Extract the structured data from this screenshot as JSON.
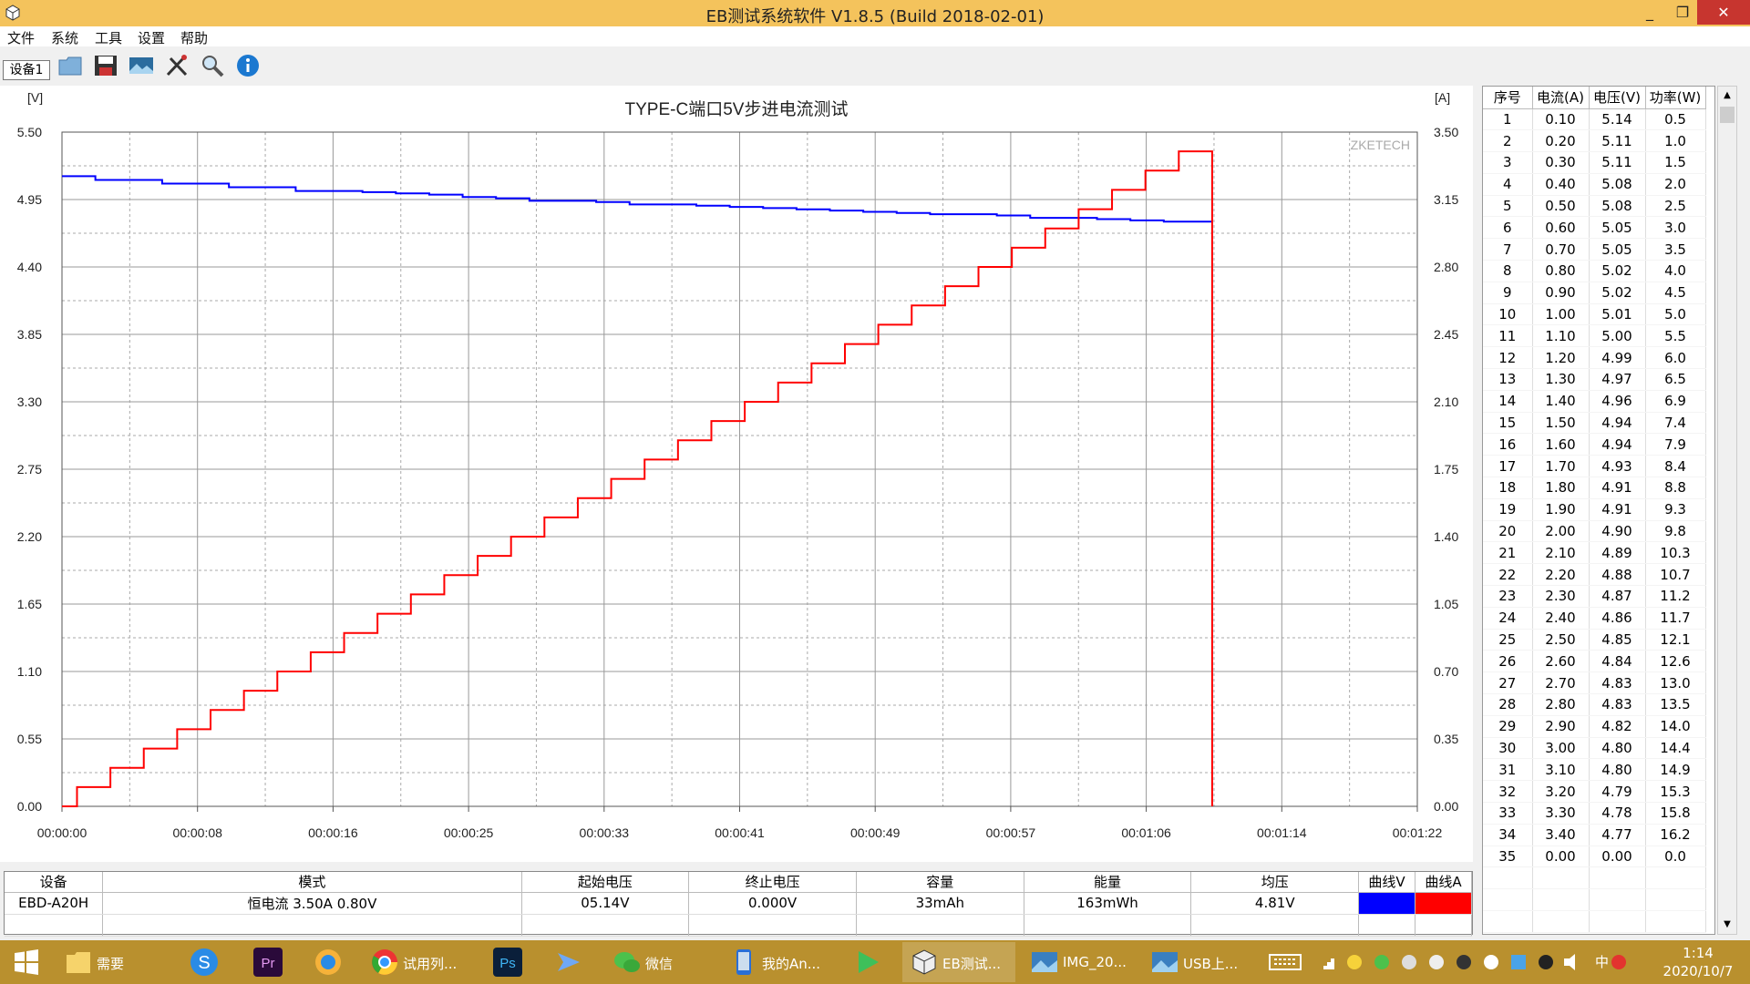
{
  "window": {
    "title": "EB测试系统软件 V1.8.5 (Build 2018-02-01)",
    "minimize": "_",
    "maximize": "❐",
    "close": "✕"
  },
  "menu": [
    "文件",
    "系统",
    "工具",
    "设置",
    "帮助"
  ],
  "toolbar": {
    "device_tab": "设备1",
    "icons": [
      "folder-icon",
      "save-icon",
      "picture-icon",
      "tools-icon",
      "search-icon",
      "info-icon"
    ]
  },
  "chart_labels": {
    "left_unit": "[V]",
    "right_unit": "[A]",
    "watermark": "ZKETECH"
  },
  "chart_data": {
    "type": "line",
    "title": "TYPE-C端口5V步进电流测试",
    "y_left": {
      "label": "[V]",
      "range": [
        0,
        5.5
      ],
      "ticks": [
        "0.00",
        "0.55",
        "1.10",
        "1.65",
        "2.20",
        "2.75",
        "3.30",
        "3.85",
        "4.40",
        "4.95",
        "5.50"
      ]
    },
    "y_right": {
      "label": "[A]",
      "range": [
        0,
        3.5
      ],
      "ticks": [
        "0.00",
        "0.35",
        "0.70",
        "1.05",
        "1.40",
        "1.75",
        "2.10",
        "2.45",
        "2.80",
        "3.15",
        "3.50"
      ]
    },
    "x": {
      "ticks": [
        "00:00:00",
        "00:00:08",
        "00:00:16",
        "00:00:25",
        "00:00:33",
        "00:00:41",
        "00:00:49",
        "00:00:57",
        "00:01:06",
        "00:01:14",
        "00:01:22"
      ]
    },
    "grid": true,
    "series": [
      {
        "name": "曲线V",
        "color": "#0000ff",
        "axis": "left",
        "values": [
          5.14,
          5.11,
          5.11,
          5.08,
          5.08,
          5.05,
          5.05,
          5.02,
          5.02,
          5.01,
          5.0,
          4.99,
          4.97,
          4.96,
          4.94,
          4.94,
          4.93,
          4.91,
          4.91,
          4.9,
          4.89,
          4.88,
          4.87,
          4.86,
          4.85,
          4.84,
          4.83,
          4.83,
          4.82,
          4.8,
          4.8,
          4.79,
          4.78,
          4.77
        ]
      },
      {
        "name": "曲线A",
        "color": "#ff0000",
        "axis": "right",
        "values": [
          0.1,
          0.2,
          0.3,
          0.4,
          0.5,
          0.6,
          0.7,
          0.8,
          0.9,
          1.0,
          1.1,
          1.2,
          1.3,
          1.4,
          1.5,
          1.6,
          1.7,
          1.8,
          1.9,
          2.0,
          2.1,
          2.2,
          2.3,
          2.4,
          2.5,
          2.6,
          2.7,
          2.8,
          2.9,
          3.0,
          3.1,
          3.2,
          3.3,
          3.4
        ]
      }
    ]
  },
  "data_table": {
    "headers": [
      "序号",
      "电流(A)",
      "电压(V)",
      "功率(W)"
    ],
    "rows": [
      [
        "1",
        "0.10",
        "5.14",
        "0.5"
      ],
      [
        "2",
        "0.20",
        "5.11",
        "1.0"
      ],
      [
        "3",
        "0.30",
        "5.11",
        "1.5"
      ],
      [
        "4",
        "0.40",
        "5.08",
        "2.0"
      ],
      [
        "5",
        "0.50",
        "5.08",
        "2.5"
      ],
      [
        "6",
        "0.60",
        "5.05",
        "3.0"
      ],
      [
        "7",
        "0.70",
        "5.05",
        "3.5"
      ],
      [
        "8",
        "0.80",
        "5.02",
        "4.0"
      ],
      [
        "9",
        "0.90",
        "5.02",
        "4.5"
      ],
      [
        "10",
        "1.00",
        "5.01",
        "5.0"
      ],
      [
        "11",
        "1.10",
        "5.00",
        "5.5"
      ],
      [
        "12",
        "1.20",
        "4.99",
        "6.0"
      ],
      [
        "13",
        "1.30",
        "4.97",
        "6.5"
      ],
      [
        "14",
        "1.40",
        "4.96",
        "6.9"
      ],
      [
        "15",
        "1.50",
        "4.94",
        "7.4"
      ],
      [
        "16",
        "1.60",
        "4.94",
        "7.9"
      ],
      [
        "17",
        "1.70",
        "4.93",
        "8.4"
      ],
      [
        "18",
        "1.80",
        "4.91",
        "8.8"
      ],
      [
        "19",
        "1.90",
        "4.91",
        "9.3"
      ],
      [
        "20",
        "2.00",
        "4.90",
        "9.8"
      ],
      [
        "21",
        "2.10",
        "4.89",
        "10.3"
      ],
      [
        "22",
        "2.20",
        "4.88",
        "10.7"
      ],
      [
        "23",
        "2.30",
        "4.87",
        "11.2"
      ],
      [
        "24",
        "2.40",
        "4.86",
        "11.7"
      ],
      [
        "25",
        "2.50",
        "4.85",
        "12.1"
      ],
      [
        "26",
        "2.60",
        "4.84",
        "12.6"
      ],
      [
        "27",
        "2.70",
        "4.83",
        "13.0"
      ],
      [
        "28",
        "2.80",
        "4.83",
        "13.5"
      ],
      [
        "29",
        "2.90",
        "4.82",
        "14.0"
      ],
      [
        "30",
        "3.00",
        "4.80",
        "14.4"
      ],
      [
        "31",
        "3.10",
        "4.80",
        "14.9"
      ],
      [
        "32",
        "3.20",
        "4.79",
        "15.3"
      ],
      [
        "33",
        "3.30",
        "4.78",
        "15.8"
      ],
      [
        "34",
        "3.40",
        "4.77",
        "16.2"
      ],
      [
        "35",
        "0.00",
        "0.00",
        "0.0"
      ]
    ]
  },
  "info_table": {
    "headers": [
      "设备",
      "模式",
      "起始电压",
      "终止电压",
      "容量",
      "能量",
      "均压",
      "曲线V",
      "曲线A"
    ],
    "values": [
      "EBD-A20H",
      "恒电流  3.50A  0.80V",
      "05.14V",
      "0.000V",
      "33mAh",
      "163mWh",
      "4.81V",
      "",
      ""
    ],
    "curve_v_color": "#0000ff",
    "curve_a_color": "#ff0000"
  },
  "taskbar": {
    "items": [
      {
        "label": "",
        "icon": "windows-start-icon"
      },
      {
        "label": "需要",
        "icon": "folder-icon"
      },
      {
        "label": "",
        "icon": "sogou-icon"
      },
      {
        "label": "",
        "icon": "premiere-icon"
      },
      {
        "label": "",
        "icon": "browser-icon"
      },
      {
        "label": "试用列...",
        "icon": "chrome-icon"
      },
      {
        "label": "",
        "icon": "photoshop-icon"
      },
      {
        "label": "",
        "icon": "feishu-icon"
      },
      {
        "label": "微信",
        "icon": "wechat-icon"
      },
      {
        "label": "我的An...",
        "icon": "phone-icon"
      },
      {
        "label": "",
        "icon": "player-icon"
      },
      {
        "label": "EB测试...",
        "icon": "eb-app-icon"
      },
      {
        "label": "IMG_20...",
        "icon": "image-icon"
      },
      {
        "label": "USB上...",
        "icon": "image-icon"
      }
    ],
    "ime": "中",
    "time": "1:14",
    "date": "2020/10/7"
  }
}
